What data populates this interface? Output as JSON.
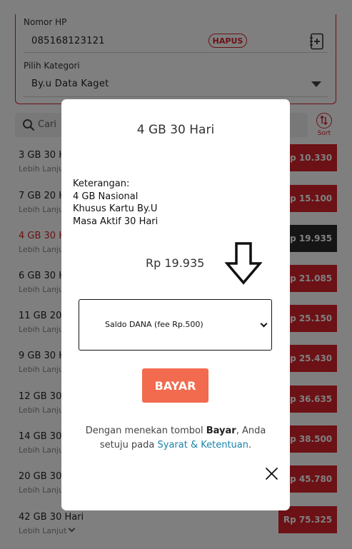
{
  "form": {
    "phone_label": "Nomor HP",
    "phone_value": "085168123121",
    "hapus_label": "HAPUS",
    "category_label": "Pilih Kategori",
    "category_value": "By.u Data Kaget"
  },
  "search": {
    "placeholder": "Cari"
  },
  "sort": {
    "label": "Sort"
  },
  "list": {
    "more_label": "Lebih Lanjut",
    "items": [
      {
        "name": "3 GB 30 Hari",
        "price": "Rp 10.330"
      },
      {
        "name": "7 GB 20 Hari",
        "price": "Rp 15.100"
      },
      {
        "name": "4 GB 30 Hari",
        "price": "Rp 19.935"
      },
      {
        "name": "6 GB 30 Hari",
        "price": "Rp 21.085"
      },
      {
        "name": "11 GB 20 Hari",
        "price": "Rp 25.150"
      },
      {
        "name": "9 GB 30 Hari",
        "price": "Rp 25.430"
      },
      {
        "name": "12 GB 30 Hari",
        "price": "Rp 36.635"
      },
      {
        "name": "14 GB 30 Hari",
        "price": "Rp 38.500"
      },
      {
        "name": "20 GB 30 Hari",
        "price": "Rp 45.780"
      },
      {
        "name": "42 GB 30 Hari",
        "price": "Rp 75.325"
      }
    ]
  },
  "modal": {
    "title": "4 GB 30 Hari",
    "desc_heading": "Keterangan:",
    "desc_line1": "4 GB Nasional",
    "desc_line2": "Khusus Kartu By.U",
    "desc_line3": "Masa Aktif 30 Hari",
    "amount": "Rp 19.935",
    "payment_method": "Saldo DANA (fee Rp.500)",
    "pay_button": "BAYAR",
    "terms_prefix": "Dengan menekan tombol ",
    "terms_bold": "Bayar",
    "terms_middle": ", Anda setuju pada ",
    "terms_link": "Syarat & Ketentuan",
    "terms_suffix": "."
  },
  "colors": {
    "brand_red": "#d9232b",
    "pay_orange": "#f26b4f",
    "link_blue": "#1a82a8"
  }
}
